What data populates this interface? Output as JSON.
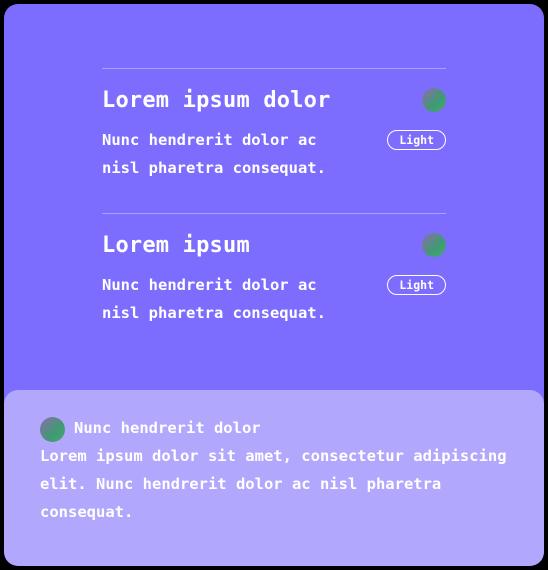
{
  "items": [
    {
      "title": "Lorem ipsum dolor",
      "description": "Nunc hendrerit dolor ac nisl pharetra consequat.",
      "badge": "Light",
      "icon": "avatar-dot"
    },
    {
      "title": "Lorem ipsum",
      "description": "Nunc hendrerit dolor ac nisl pharetra consequat.",
      "badge": "Light",
      "icon": "avatar-dot"
    }
  ],
  "footer": {
    "heading": "Nunc hendrerit dolor",
    "body": "Lorem ipsum dolor sit amet, consectetur adipiscing elit. Nunc hendrerit dolor ac nisl pharetra consequat."
  },
  "colors": {
    "card_bg": "#7d6dff",
    "footer_bg": "#b1a7fc",
    "page_bg": "#000000",
    "text": "#ffffff"
  }
}
